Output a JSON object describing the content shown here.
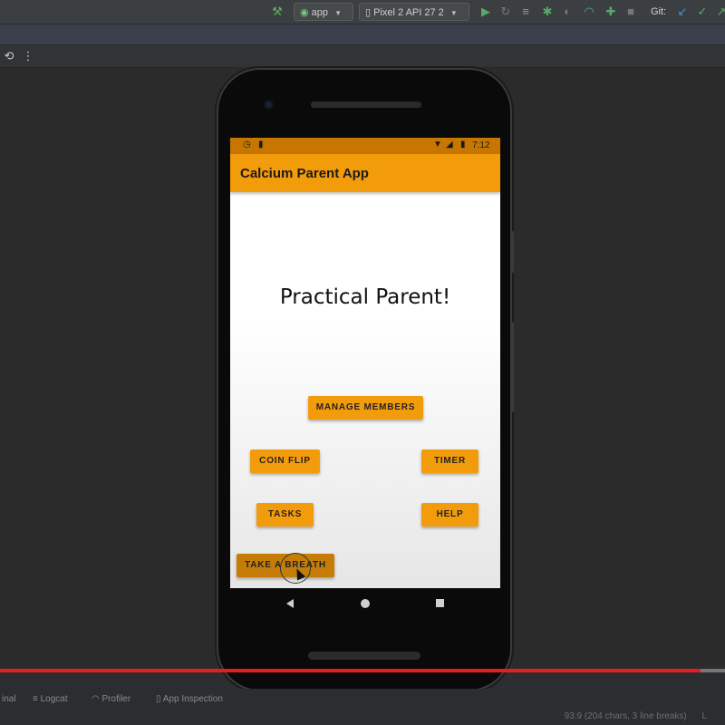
{
  "ide": {
    "run_config": "app",
    "device": "Pixel 2 API 27 2",
    "vcs_label": "Git:",
    "bottom_tabs": [
      "inal",
      "Logcat",
      "Profiler",
      "App Inspection"
    ],
    "status_text": "93:9 (204 chars, 3 line breaks)",
    "status_suffix": "L"
  },
  "phone": {
    "status_bar": {
      "time": "7:12"
    },
    "app_title": "Calcium Parent App",
    "headline": "Practical Parent!",
    "buttons": {
      "manage_members": "MANAGE MEMBERS",
      "coin_flip": "COIN FLIP",
      "timer": "TIMER",
      "tasks": "TASKS",
      "help": "HELP",
      "take_a_breath": "TAKE A BREATH"
    }
  },
  "video": {
    "progress_fraction": 0.966
  },
  "colors": {
    "primary": "#f39c0b",
    "primary_dark": "#c77700",
    "progress": "#e61e1e"
  }
}
